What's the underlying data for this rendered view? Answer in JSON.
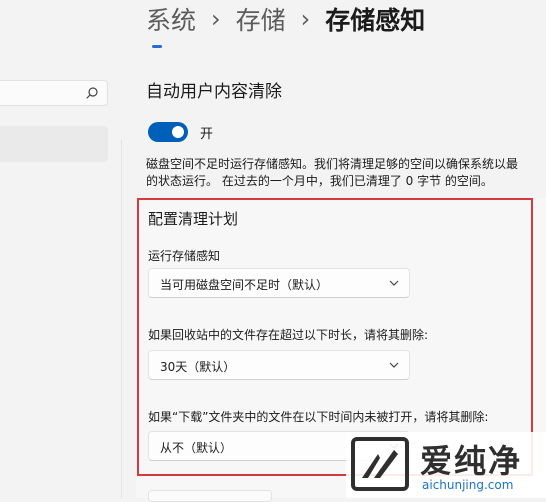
{
  "breadcrumb": {
    "items": [
      "系统",
      "存储",
      "存储感知"
    ],
    "separator": "›"
  },
  "section": {
    "title": "自动用户内容清除",
    "toggle_label": "开",
    "toggle_on": true,
    "description_line1": "磁盘空间不足时运行存储感知。我们将清理足够的空间以确保系统以最",
    "description_line2": "的状态运行。 在过去的一个月中，我们已清理了 0 字节 的空间。"
  },
  "schedule": {
    "title": "配置清理计划",
    "run_label": "运行存储感知",
    "run_value": "当可用磁盘空间不足时（默认）",
    "recycle_label": "如果回收站中的文件存在超过以下时长，请将其删除:",
    "recycle_value": "30天（默认）",
    "downloads_label": "如果“下载”文件夹中的文件在以下时间内未被打开，请将其删除:",
    "downloads_value": "从不（默认）"
  },
  "watermark": {
    "brand": "爱纯净",
    "domain": "aichunjing.com"
  },
  "colors": {
    "accent": "#005fb8",
    "highlight_border": "#d63b3b",
    "watermark_link": "#1a73c8"
  },
  "icons": {
    "search": "search-icon",
    "dropdown": "chevron-down-icon",
    "watermark_logo": "aichunjing-logo"
  }
}
